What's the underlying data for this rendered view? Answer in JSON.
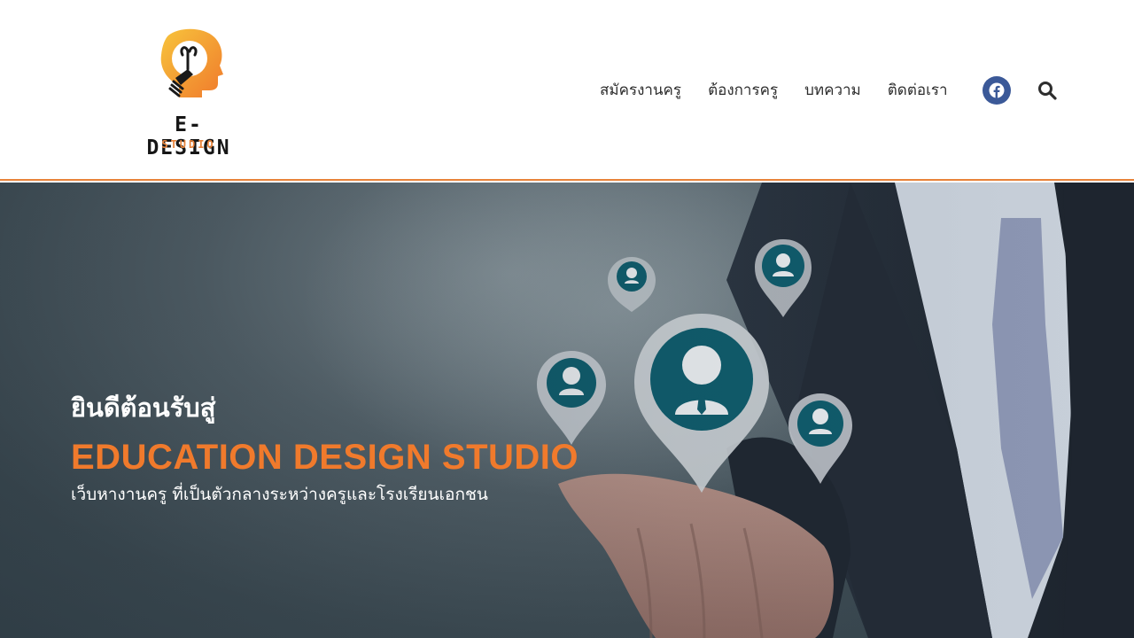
{
  "header": {
    "logo": {
      "icon": "lightbulb-head-icon",
      "wordmark": "E-DESIGN",
      "subtitle": "STUDIO"
    },
    "nav": [
      {
        "label": "สมัครงานครู"
      },
      {
        "label": "ต้องการครู"
      },
      {
        "label": "บทความ"
      },
      {
        "label": "ติดต่อเรา"
      }
    ],
    "social": {
      "icon": "facebook-icon"
    },
    "search": {
      "icon": "search-icon"
    }
  },
  "hero": {
    "welcome": "ยินดีต้อนรับสู่",
    "title": "EDUCATION DESIGN STUDIO",
    "subtitle": "เว็บหางานครู ที่เป็นตัวกลางระหว่างครูและโรงเรียนเอกชน"
  },
  "colors": {
    "accent": "#f07a2c",
    "header_border": "#e8833a",
    "facebook": "#3b5998",
    "nav_text": "#2d2d2d",
    "pin_fill": "#0f5b6b"
  }
}
